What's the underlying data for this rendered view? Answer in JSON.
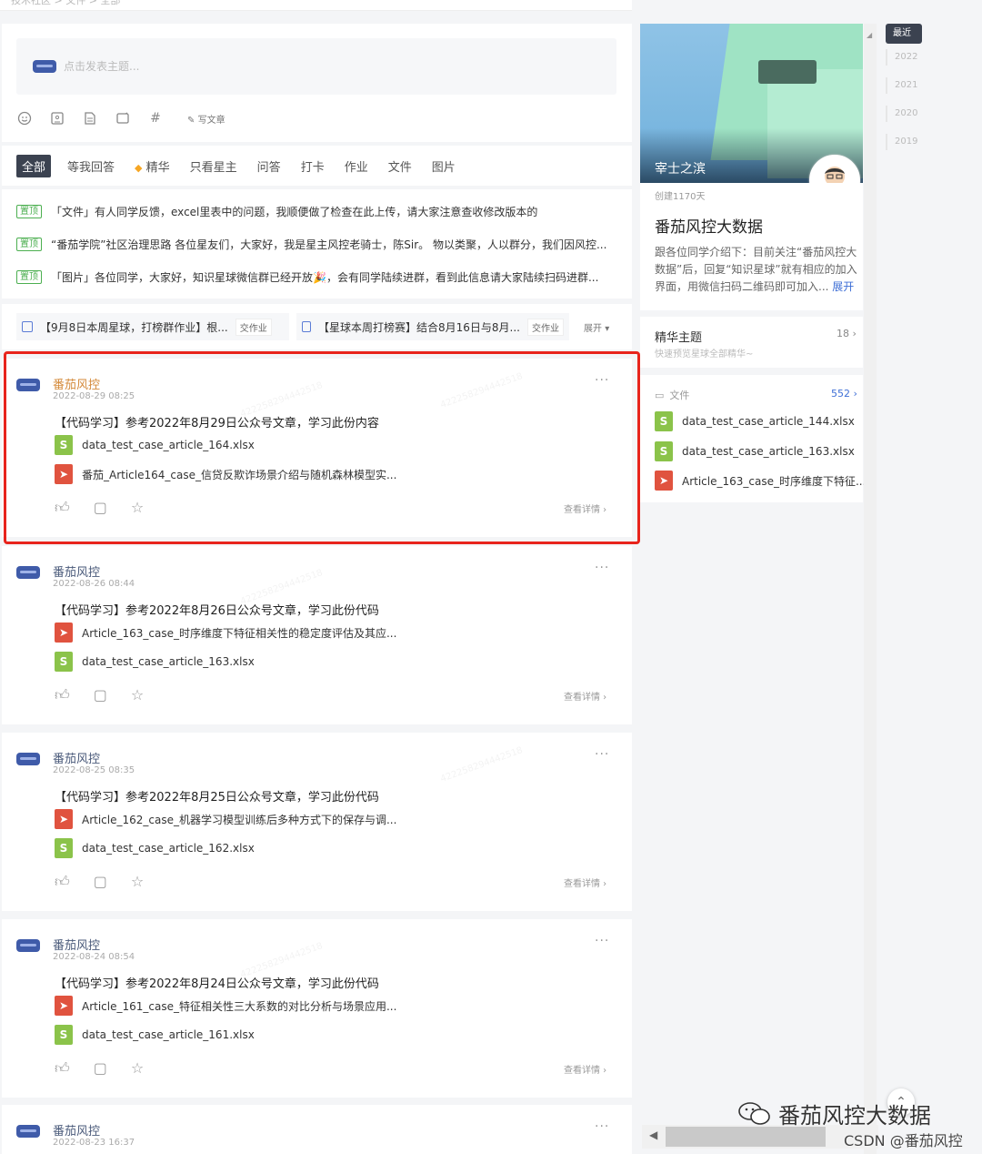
{
  "top": {
    "breadcrumb": "技术社区 > 文件 > 全部"
  },
  "composer": {
    "placeholder": "点击发表主题...",
    "write_label": "写文章",
    "hash_symbol": "#"
  },
  "tabs": [
    {
      "label": "全部",
      "active": true
    },
    {
      "label": "等我回答"
    },
    {
      "label": "精华"
    },
    {
      "label": "只看星主"
    },
    {
      "label": "问答"
    },
    {
      "label": "打卡"
    },
    {
      "label": "作业"
    },
    {
      "label": "文件"
    },
    {
      "label": "图片"
    }
  ],
  "pinned": {
    "badge": "置顶",
    "items": [
      "「文件」有人同学反馈，excel里表中的问题，我顺便做了检查在此上传，请大家注意查收修改版本的",
      "“番茄学院”社区治理思路 各位星友们，大家好，我是星主风控老骑士，陈Sir。 物以类聚，人以群分，我们因风控...",
      "「图片」各位同学，大家好，知识星球微信群已经开放🎉，会有同学陆续进群，看到此信息请大家陆续扫码进群..."
    ]
  },
  "homework": {
    "items": [
      {
        "text": "【9月8日本周星球，打榜群作业】根...",
        "tag": "交作业"
      },
      {
        "text": "【星球本周打榜赛】结合8月16日与8月...",
        "tag": "交作业"
      }
    ],
    "expand": "展开"
  },
  "posts": [
    {
      "author": "番茄风控",
      "time": "2022-08-29 08:25",
      "title": "【代码学习】参考2022年8月29日公众号文章，学习此份内容",
      "files": [
        {
          "type": "xls",
          "name": "data_test_case_article_164.xlsx"
        },
        {
          "type": "pdf",
          "name": "番茄_Article164_case_信贷反欺诈场景介绍与随机森林模型实..."
        }
      ],
      "detail": "查看详情 ›"
    },
    {
      "author": "番茄风控",
      "time": "2022-08-26 08:44",
      "title": "【代码学习】参考2022年8月26日公众号文章，学习此份代码",
      "files": [
        {
          "type": "pdf",
          "name": "Article_163_case_时序维度下特征相关性的稳定度评估及其应..."
        },
        {
          "type": "xls",
          "name": "data_test_case_article_163.xlsx"
        }
      ],
      "detail": "查看详情 ›"
    },
    {
      "author": "番茄风控",
      "time": "2022-08-25 08:35",
      "title": "【代码学习】参考2022年8月25日公众号文章，学习此份代码",
      "files": [
        {
          "type": "pdf",
          "name": "Article_162_case_机器学习模型训练后多种方式下的保存与调..."
        },
        {
          "type": "xls",
          "name": "data_test_case_article_162.xlsx"
        }
      ],
      "detail": "查看详情 ›"
    },
    {
      "author": "番茄风控",
      "time": "2022-08-24 08:54",
      "title": "【代码学习】参考2022年8月24日公众号文章，学习此份代码",
      "files": [
        {
          "type": "pdf",
          "name": "Article_161_case_特征相关性三大系数的对比分析与场景应用..."
        },
        {
          "type": "xls",
          "name": "data_test_case_article_161.xlsx"
        }
      ],
      "detail": "查看详情 ›"
    },
    {
      "author": "番茄风控",
      "time": "2022-08-23 16:37",
      "title": "",
      "files": [],
      "detail": ""
    }
  ],
  "watermark": "422258294442518",
  "sidebar": {
    "banner_name": "宰士之滨",
    "created": "创建1170天",
    "group_name": "番茄风控大数据",
    "desc": "跟各位同学介绍下：目前关注“番茄风控大数据”后，回复“知识星球”就有相应的加入界面，用微信扫码二维码即可加入...",
    "expand": "展开",
    "feature_title": "精华主题",
    "feature_sub": "快速预览星球全部精华~",
    "feature_count": "18 ›",
    "files_title": "文件",
    "files_count": "552 ›",
    "files": [
      {
        "type": "xls",
        "name": "data_test_case_article_144.xlsx"
      },
      {
        "type": "xls",
        "name": "data_test_case_article_163.xlsx"
      },
      {
        "type": "pdf",
        "name": "Article_163_case_时序维度下特征..."
      }
    ]
  },
  "years": [
    "最近",
    "2022",
    "2021",
    "2020",
    "2019"
  ],
  "overlay": {
    "wechat": "番茄风控大数据",
    "csdn": "CSDN @番茄风控"
  },
  "colors": {
    "accent": "#3f6fd6",
    "highlight_box": "#e8241c",
    "pin": "#4caf50"
  }
}
